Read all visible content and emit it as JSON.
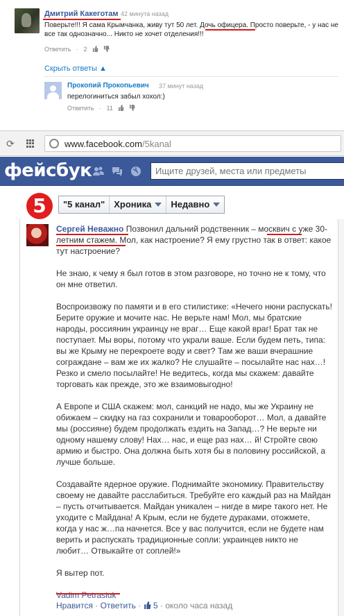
{
  "comments": {
    "first": {
      "author": "Дмитрий Какеготам",
      "time": "42 минута назад",
      "text": "Поверьте!!! Я сама Крымчанка, живу тут 50 лет. Дочь офицера. Просто поверьте, - у нас не все так однозначно... Никто не хочет отделения!!!",
      "reply_label": "Ответить",
      "likes": "2"
    },
    "show_replies": "Скрыть ответы ▲",
    "reply": {
      "author": "Прокопий Прокопьевич",
      "time": "37 минут назад",
      "text": "перелогиниться забыл хохол:)",
      "reply_label": "Ответить",
      "likes": "11"
    }
  },
  "browser": {
    "back_icon": "reload-icon",
    "url_host": "www.facebook.com",
    "url_path": "/5kanal"
  },
  "facebook": {
    "logo": "фейсбук",
    "search_placeholder": "Ищите друзей, места или предметы"
  },
  "page": {
    "logo_text": "5",
    "nav": [
      "\"5 канал\"",
      "Хроника",
      "Недавно"
    ]
  },
  "post": {
    "author": "Сергей Неважно",
    "paragraphs": [
      "Позвонил дальний родственник – москвич с уже 30-летним стажем. Мол, как настроение? Я ему грустно так в ответ: какое тут настроение?",
      "Не знаю, к чему я был готов в этом разговоре, но точно не к тому, что он мне ответил.",
      "Воспроизвожу по памяти и в его стилистике: «Нечего нюни распускать! Берите оружие и мочите нас. Не верьте нам! Мол, мы братские народы, россиянин украинцу не враг… Еще какой враг! Брат так не поступает. Мы воры, потому что украли ваше. Если будем петь, типа: вы же Крыму не перекроете воду и свет? Там же ваши вчерашние сограждане – вам же их жалко? Не слушайте – посылайте нас нах…! Резко и смело посылайте! Не ведитесь, когда мы скажем: давайте торговать как прежде, это же взаимовыгодно!",
      "А Европе и США скажем: мол, санкций не надо, мы же Украину не обижаем – скидку на газ сохранили и товарооборот… Мол, а давайте мы (россияне) будем продолжать ездить на Запад…? Не верьте ни одному нашему слову! Нах… нас, и еще раз нах… й! Стройте свою армию и быстро. Она должна быть хотя бы в половину российской, а лучше больше.",
      "Создавайте ядерное оружие. Поднимайте экономику. Правительству своему не давайте расслабиться. Требуйте его каждый раз на Майдан – пусть отчитывается. Майдан уникален – нигде в мире такого нет. Не уходите с Майдана! А Крым, если не будете дураками, отожмете, когда у нас ж…па начнется. Все у вас получится, если не будете нам верить и распускать традиционные сопли: украинцев никто не любит… Отвыкайте от соплей!»",
      "Я вытер пот."
    ],
    "signature": "Vadim Petrasiuk",
    "actions": {
      "like": "Нравится",
      "reply": "Ответить",
      "likes_count": "5",
      "time": "около часа назад"
    }
  }
}
